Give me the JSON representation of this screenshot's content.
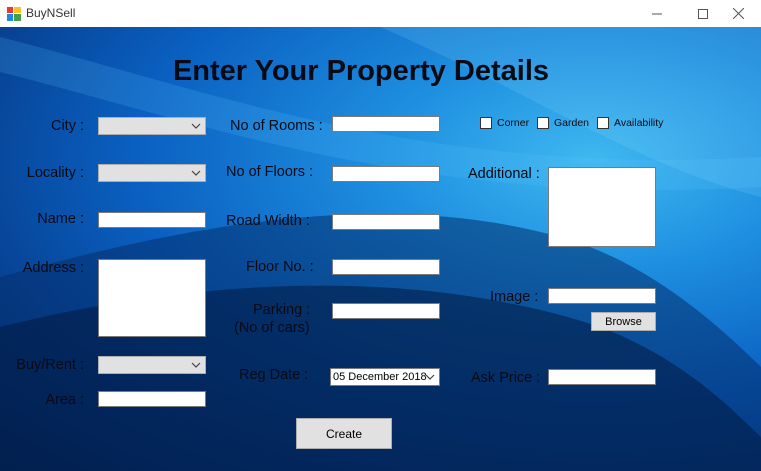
{
  "window": {
    "title": "BuyNSell"
  },
  "form": {
    "heading": "Enter Your Property Details",
    "city_label": "City :",
    "locality_label": "Locality :",
    "name_label": "Name :",
    "address_label": "Address :",
    "buy_rent_label": "Buy/Rent :",
    "area_label": "Area :",
    "rooms_label": "No of Rooms :",
    "floors_label": "No of Floors :",
    "road_width_label": "Road Width :",
    "floor_no_label": "Floor No. :",
    "parking_label": "Parking :",
    "parking_sub_label": "(No of cars)",
    "reg_date_label": "Reg Date :",
    "reg_date_value": "05 December 2018",
    "corner_label": "Corner",
    "garden_label": "Garden",
    "availability_label": "Availability",
    "additional_label": "Additional :",
    "image_label": "Image :",
    "browse_label": "Browse",
    "ask_price_label": "Ask Price :",
    "create_label": "Create"
  },
  "colors": {
    "bg_light": "#3fb8f0",
    "bg_dark": "#031f4e",
    "control_gray": "#e1e1e1"
  }
}
